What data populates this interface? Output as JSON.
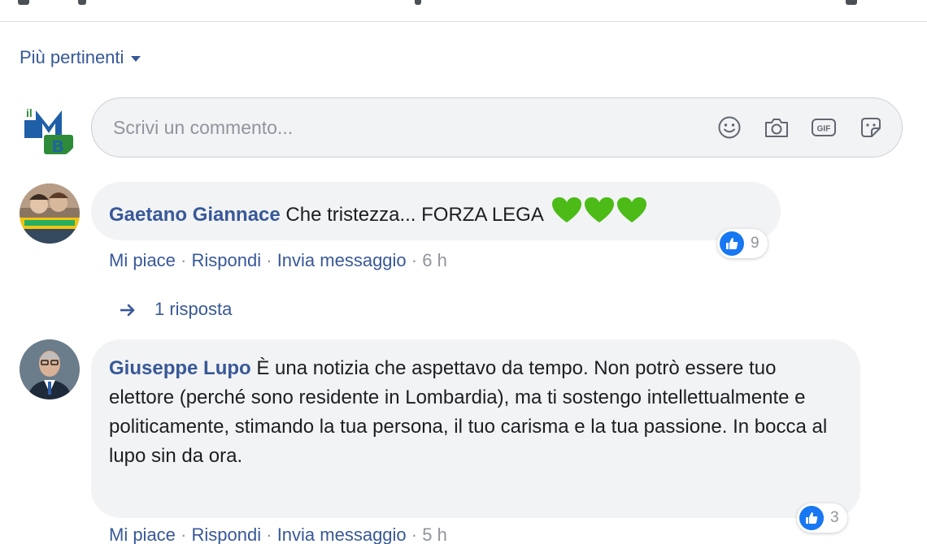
{
  "sort": {
    "label": "Più pertinenti"
  },
  "composer": {
    "placeholder": "Scrivi un commento..."
  },
  "comments": [
    {
      "author": "Gaetano Giannace",
      "text": "Che tristezza... FORZA LEGA",
      "emoji": [
        "green-heart",
        "green-heart",
        "green-heart"
      ],
      "reaction_count": "9",
      "actions": {
        "like": "Mi piace",
        "reply": "Rispondi",
        "message": "Invia messaggio",
        "time": "6 h"
      },
      "replies_label": "1 risposta"
    },
    {
      "author": "Giuseppe Lupo",
      "text": "È una notizia che aspettavo da tempo. Non potrò essere tuo elettore (perché sono residente in Lombardia), ma ti sostengo intellettualmente e politicamente, stimando la tua persona, il tuo carisma e la tua passione. In bocca al lupo sin da ora.",
      "reaction_count": "3",
      "actions": {
        "like": "Mi piace",
        "reply": "Rispondi",
        "message": "Invia messaggio",
        "time": "5 h"
      }
    }
  ],
  "actions_separator": "·",
  "colors": {
    "link": "#385898",
    "bubble": "#f2f3f5",
    "like_blue": "#1877f2",
    "heart_green": "#4cbb17"
  }
}
